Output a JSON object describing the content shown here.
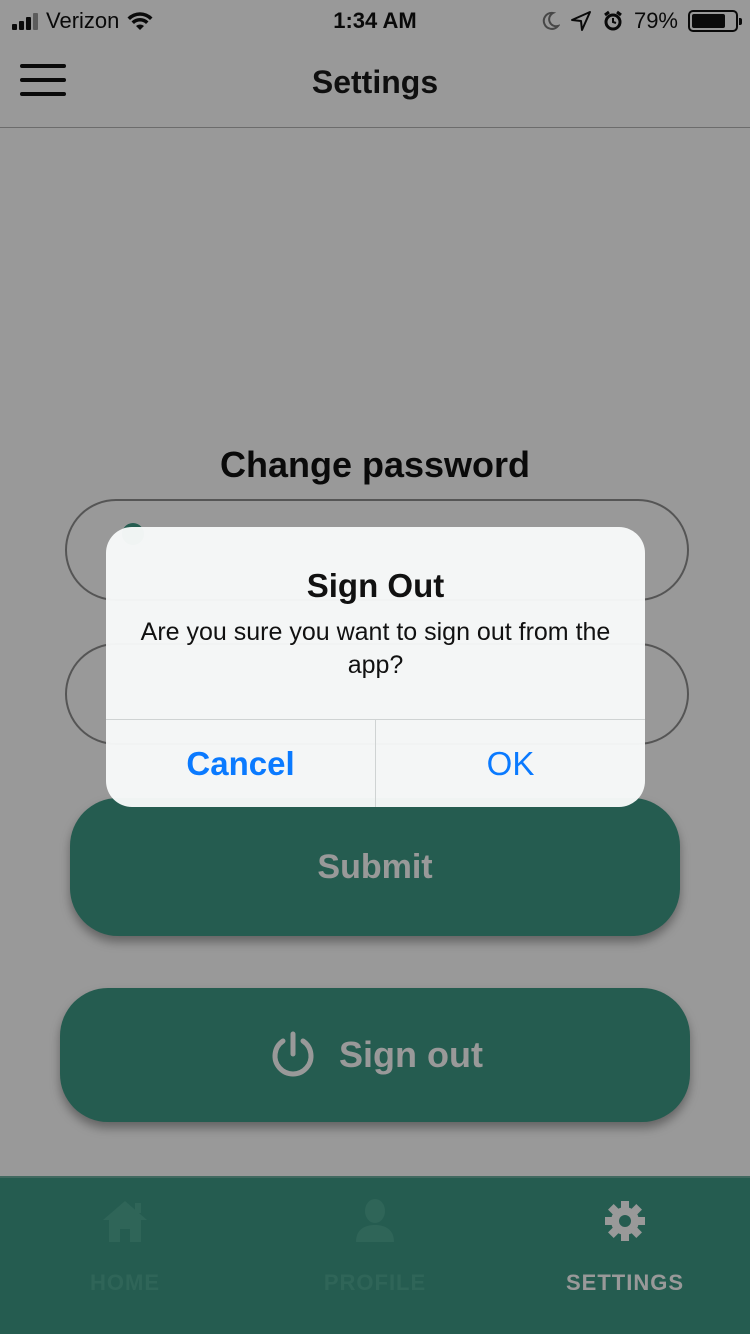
{
  "status_bar": {
    "carrier": "Verizon",
    "time": "1:34 AM",
    "battery": "79%",
    "battery_level": 0.79,
    "icons": [
      "signal-icon",
      "wifi-icon",
      "moon-icon",
      "location-arrow-icon",
      "alarm-icon",
      "battery-icon"
    ]
  },
  "nav": {
    "title": "Settings",
    "menu_icon": "hamburger-menu-icon"
  },
  "main": {
    "section_title": "Change password",
    "submit_label": "Submit",
    "signout_label": "Sign out",
    "signout_icon": "power-icon"
  },
  "tab_bar": {
    "tabs": [
      {
        "label": "HOME",
        "icon": "home-icon",
        "active": false
      },
      {
        "label": "PROFILE",
        "icon": "person-icon",
        "active": false
      },
      {
        "label": "SETTINGS",
        "icon": "gear-icon",
        "active": true
      }
    ]
  },
  "alert": {
    "title": "Sign Out",
    "message": "Are you sure you want to sign out from the app?",
    "cancel_label": "Cancel",
    "ok_label": "OK"
  },
  "colors": {
    "accent": "#3f9a86",
    "ios_blue": "#0a7aff",
    "overlay": "rgba(0,0,0,0.40)"
  }
}
